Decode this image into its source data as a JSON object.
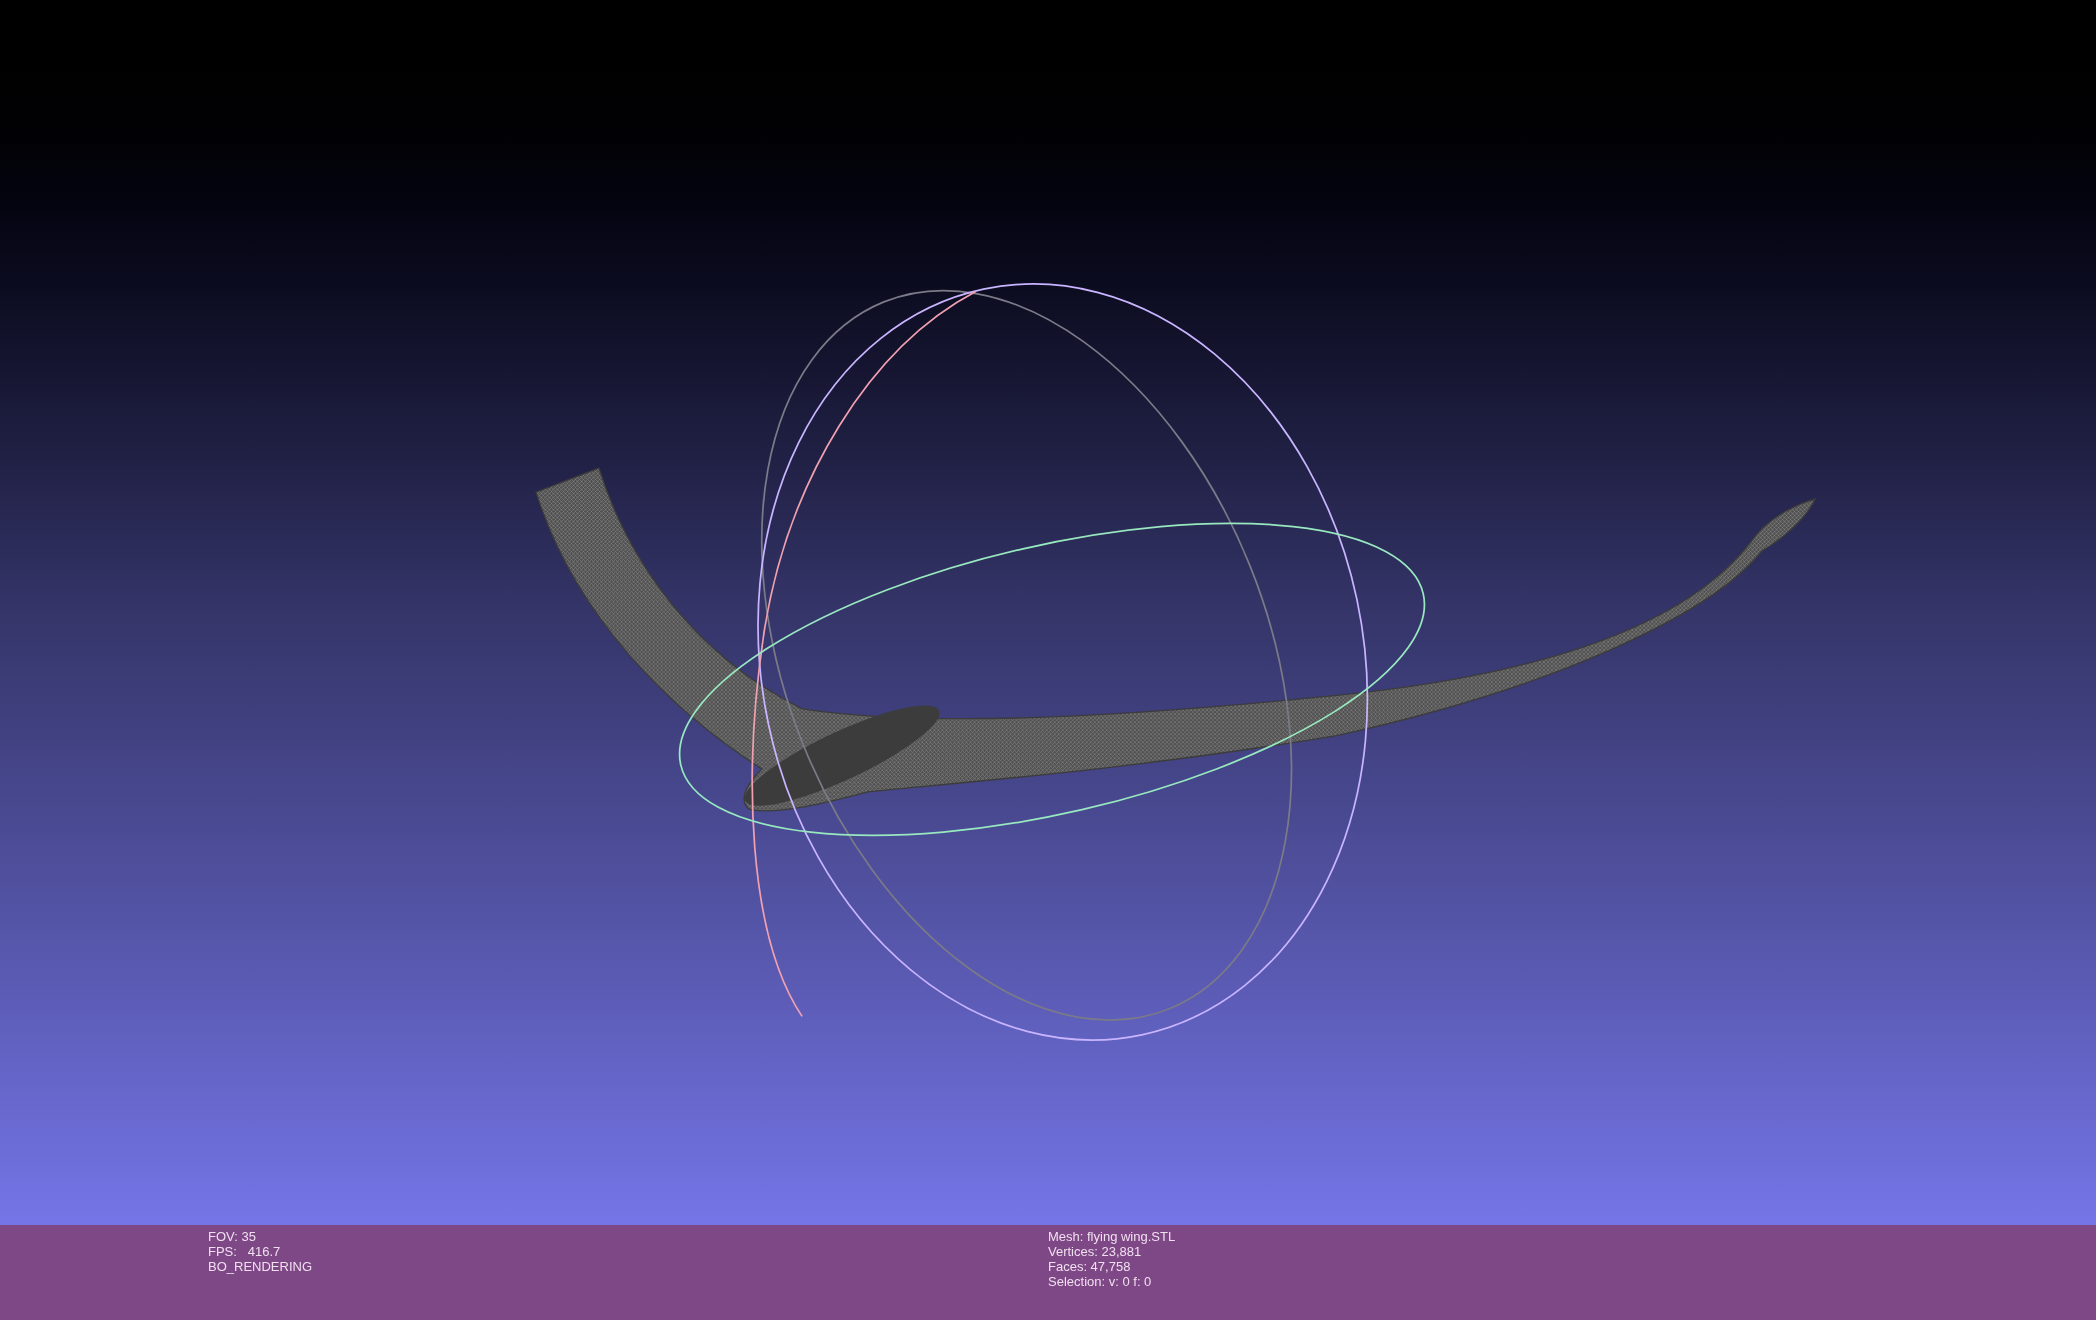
{
  "info_panel": {
    "left_lines": [
      "FOV: 35",
      "FPS:   416.7",
      "BO_RENDERING"
    ],
    "right_lines": [
      "Mesh: flying wing.STL",
      "Vertices: 23,881",
      "Faces: 47,758",
      "Selection: v: 0 f: 0"
    ]
  }
}
